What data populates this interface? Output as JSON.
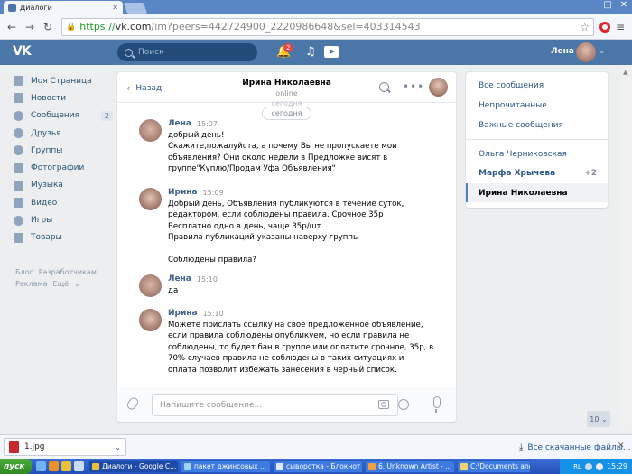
{
  "browser": {
    "tab_title": "Диалоги",
    "url_proto": "https://",
    "url_host": "vk.com",
    "url_rest": "/im?peers=442724900_2220986648&sel=403314543"
  },
  "vk": {
    "search_placeholder": "Поиск",
    "notif_count": "2",
    "user_name": "Лена"
  },
  "leftnav": [
    {
      "label": "Моя Страница"
    },
    {
      "label": "Новости"
    },
    {
      "label": "Сообщения",
      "count": "2"
    },
    {
      "label": "Друзья"
    },
    {
      "label": "Группы"
    },
    {
      "label": "Фотографии"
    },
    {
      "label": "Музыка"
    },
    {
      "label": "Видео"
    },
    {
      "label": "Игры"
    },
    {
      "label": "Товары"
    }
  ],
  "footer": {
    "blog": "Блог",
    "dev": "Разработчикам",
    "ads": "Реклама",
    "more": "Ещё"
  },
  "chat": {
    "back": "Назад",
    "peer_name": "Ирина Николаевна",
    "peer_status": "online",
    "date_ghost": "сегодня",
    "date_pill": "сегодня",
    "messages": [
      {
        "author": "Лена",
        "time": "15:07",
        "text": "добрый день!\nСкажите,пожалуйста, а почему Вы не пропускаете мои\nобъявления? Они около недели в Предложке висят в\nгруппе\"Куплю/Продам Уфа Объявления\""
      },
      {
        "author": "Ирина",
        "time": "15:09",
        "text": "Добрый день, Объявления публикуются в течение суток,\nредактором, если соблюдены правила. Срочное 35р\nБесплатно одно в день, чаще 35р/шт\nПравила публикаций указаны наверху группы\n\nСоблюдены правила?"
      },
      {
        "author": "Лена",
        "time": "15:10",
        "text": "да"
      },
      {
        "author": "Ирина",
        "time": "15:10",
        "text": "Можете прислать ссылку на своё предложенное объявление,\nесли правила соблюдены опубликуем, но если правила не\nсоблюдены, то будет бан в группе или оплатите срочное, 35р, в\n70% случаев правила не соблюдены в таких ситуациях и\nоплата позволит избежать занесения в черный список."
      }
    ],
    "composer_placeholder": "Напишите сообщение..."
  },
  "right": {
    "all": "Все сообщения",
    "unread": "Непрочитанные",
    "important": "Важные сообщения",
    "convs": [
      {
        "name": "Ольга Черниковская",
        "count": ""
      },
      {
        "name": "Марфа Хрычева",
        "count": "+2"
      },
      {
        "name": "Ирина Николаевна",
        "count": ""
      }
    ],
    "scroll_count": "10"
  },
  "downloads": {
    "file": "1.jpg",
    "all": "Все скачанные файлы..."
  },
  "taskbar": {
    "start": "пуск",
    "tasks": [
      "Диалоги - Google C...",
      "пакет джинсовых ...",
      "сыворотка - Блокнот",
      "6. Unknown Artist - ...",
      "C:\\Documents and S..."
    ],
    "lang": "RL",
    "clock": "15:29"
  },
  "colors": {
    "vk_blue": "#4a76a8",
    "link": "#2a5885",
    "author": "#42648b"
  }
}
